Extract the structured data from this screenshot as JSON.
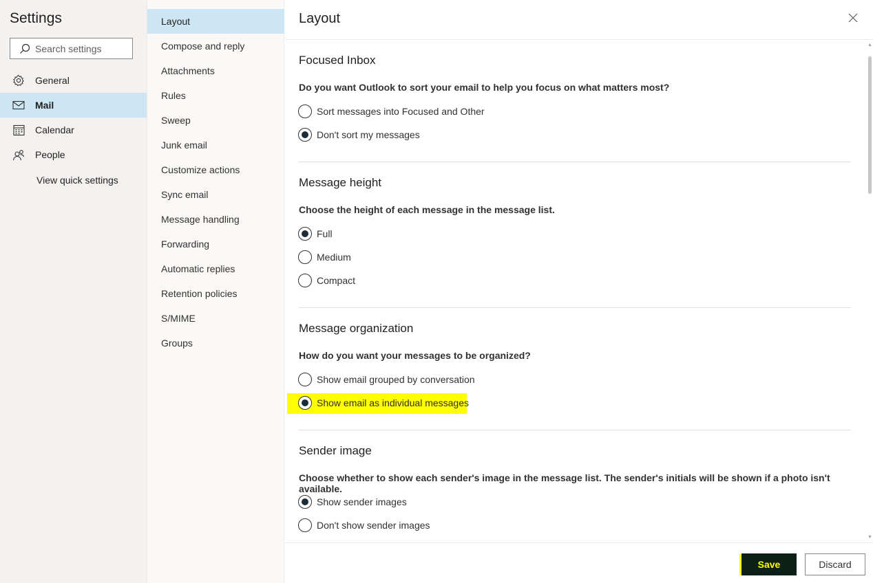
{
  "settings": {
    "title": "Settings",
    "search_placeholder": "Search settings",
    "nav": [
      {
        "label": "General",
        "icon": "gear-icon"
      },
      {
        "label": "Mail",
        "icon": "mail-icon"
      },
      {
        "label": "Calendar",
        "icon": "calendar-icon"
      },
      {
        "label": "People",
        "icon": "people-icon"
      }
    ],
    "active_nav": "Mail",
    "quick_settings_label": "View quick settings"
  },
  "mail_menu": {
    "items": [
      "Layout",
      "Compose and reply",
      "Attachments",
      "Rules",
      "Sweep",
      "Junk email",
      "Customize actions",
      "Sync email",
      "Message handling",
      "Forwarding",
      "Automatic replies",
      "Retention policies",
      "S/MIME",
      "Groups"
    ],
    "active": "Layout"
  },
  "layout": {
    "title": "Layout",
    "sections": [
      {
        "title": "Focused Inbox",
        "question": "Do you want Outlook to sort your email to help you focus on what matters most?",
        "options": [
          "Sort messages into Focused and Other",
          "Don't sort my messages"
        ],
        "selected": "Don't sort my messages"
      },
      {
        "title": "Message height",
        "question": "Choose the height of each message in the message list.",
        "options": [
          "Full",
          "Medium",
          "Compact"
        ],
        "selected": "Full"
      },
      {
        "title": "Message organization",
        "question": "How do you want your messages to be organized?",
        "options": [
          "Show email grouped by conversation",
          "Show email as individual messages"
        ],
        "selected": "Show email as individual messages"
      },
      {
        "title": "Sender image",
        "question": "Choose whether to show each sender's image in the message list. The sender's initials will be shown if a photo isn't available.",
        "options": [
          "Show sender images",
          "Don't show sender images"
        ],
        "selected": "Show sender images"
      }
    ]
  },
  "footer": {
    "save_label": "Save",
    "discard_label": "Discard"
  },
  "colors": {
    "selected_bg": "#cce7f3",
    "highlight": "#ffff00",
    "save_bg": "#0b2016"
  }
}
